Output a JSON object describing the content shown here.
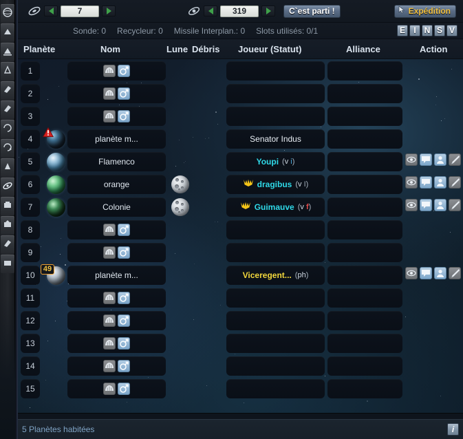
{
  "toolbar": {
    "galaxy_icon": "galaxy-icon",
    "galaxy_value": "7",
    "system_icon": "solar-system-icon",
    "system_value": "319",
    "go_label": "C`est parti !",
    "expedition_label": "Expédition",
    "prev_label": "◀",
    "next_label": "▶"
  },
  "info": {
    "probe": "Sonde: 0",
    "recycler": "Recycleur: 0",
    "missile": "Missile Interplan.: 0",
    "slots": "Slots utilisés: 0/1",
    "filters": [
      "E",
      "I",
      "N",
      "S",
      "V"
    ]
  },
  "columns": {
    "planet": "Planète",
    "name": "Nom",
    "moon": "Lune",
    "debris": "Débris",
    "player": "Joueur (Statut)",
    "alliance": "Alliance",
    "action": "Action"
  },
  "actions": {
    "spy": "espionage-icon",
    "message": "message-icon",
    "buddy": "buddy-icon",
    "attack": "missile-attack-icon"
  },
  "empty_slot": {
    "colonize": "colonize-icon",
    "deploy": "deploy-icon"
  },
  "rows": [
    {
      "num": "1",
      "occupied": false,
      "name": "",
      "moon": false,
      "player": "",
      "status": "",
      "alliance": ""
    },
    {
      "num": "2",
      "occupied": false,
      "name": "",
      "moon": false,
      "player": "",
      "status": "",
      "alliance": ""
    },
    {
      "num": "3",
      "occupied": false,
      "name": "",
      "moon": false,
      "player": "",
      "status": "",
      "alliance": ""
    },
    {
      "num": "4",
      "occupied": true,
      "planet_class": "p-darkblue",
      "warning": true,
      "name": "planète m...",
      "moon": false,
      "player": "Senator Indus",
      "player_color": "neutral",
      "status": "",
      "alliance": "",
      "has_actions": false
    },
    {
      "num": "5",
      "occupied": true,
      "planet_class": "p-blue",
      "name": "Flamenco",
      "moon": false,
      "player": "Youpi",
      "player_color": "cyan",
      "status_parts": [
        [
          "v",
          "st-v"
        ],
        [
          "i",
          "st-i"
        ]
      ],
      "alliance": "",
      "has_actions": true
    },
    {
      "num": "6",
      "occupied": true,
      "planet_class": "p-green1",
      "name": "orange",
      "moon": true,
      "player": "dragibus",
      "player_color": "cyan",
      "rank_icon": true,
      "status_parts": [
        [
          "v",
          "st-v"
        ],
        [
          "I",
          "st-I"
        ]
      ],
      "alliance": "",
      "has_actions": true
    },
    {
      "num": "7",
      "occupied": true,
      "planet_class": "p-green2",
      "name": "Colonie",
      "moon": true,
      "player": "Guimauve",
      "player_color": "cyan",
      "rank_icon": true,
      "status_parts": [
        [
          "v",
          "st-v"
        ],
        [
          "f",
          "st-f"
        ]
      ],
      "alliance": "",
      "has_actions": true
    },
    {
      "num": "8",
      "occupied": false,
      "name": "",
      "moon": false,
      "player": "",
      "status": "",
      "alliance": ""
    },
    {
      "num": "9",
      "occupied": false,
      "name": "",
      "moon": false,
      "player": "",
      "status": "",
      "alliance": ""
    },
    {
      "num": "10",
      "occupied": true,
      "planet_class": "p-gray",
      "badge": "49",
      "name": "planète m...",
      "moon": false,
      "player": "Viceregent...",
      "player_color": "yellow",
      "status_parts": [
        [
          "ph",
          "st-ph"
        ]
      ],
      "alliance": "",
      "has_actions": true
    },
    {
      "num": "11",
      "occupied": false,
      "name": "",
      "moon": false,
      "player": "",
      "status": "",
      "alliance": ""
    },
    {
      "num": "12",
      "occupied": false,
      "name": "",
      "moon": false,
      "player": "",
      "status": "",
      "alliance": ""
    },
    {
      "num": "13",
      "occupied": false,
      "name": "",
      "moon": false,
      "player": "",
      "status": "",
      "alliance": ""
    },
    {
      "num": "14",
      "occupied": false,
      "name": "",
      "moon": false,
      "player": "",
      "status": "",
      "alliance": ""
    },
    {
      "num": "15",
      "occupied": false,
      "name": "",
      "moon": false,
      "player": "",
      "status": "",
      "alliance": ""
    }
  ],
  "footer": {
    "summary": "5 Planètes habitées",
    "info_label": "i"
  },
  "colors": {
    "accent_cyan": "#2fd9e8",
    "accent_yellow": "#f2d73c",
    "status_enemy": "#e24b4b",
    "button_blue": "#5b6d86",
    "nav_green": "#3fa24a",
    "badge_border": "#f0a030"
  },
  "rail_icons": [
    "overview-icon",
    "resources-icon",
    "facilities-icon",
    "research-icon",
    "shipyard-icon",
    "defense-icon",
    "fleet-icon",
    "movement-icon",
    "galaxy-icon",
    "alliance-icon",
    "merchant-icon",
    "officers-icon",
    "shop-icon"
  ]
}
